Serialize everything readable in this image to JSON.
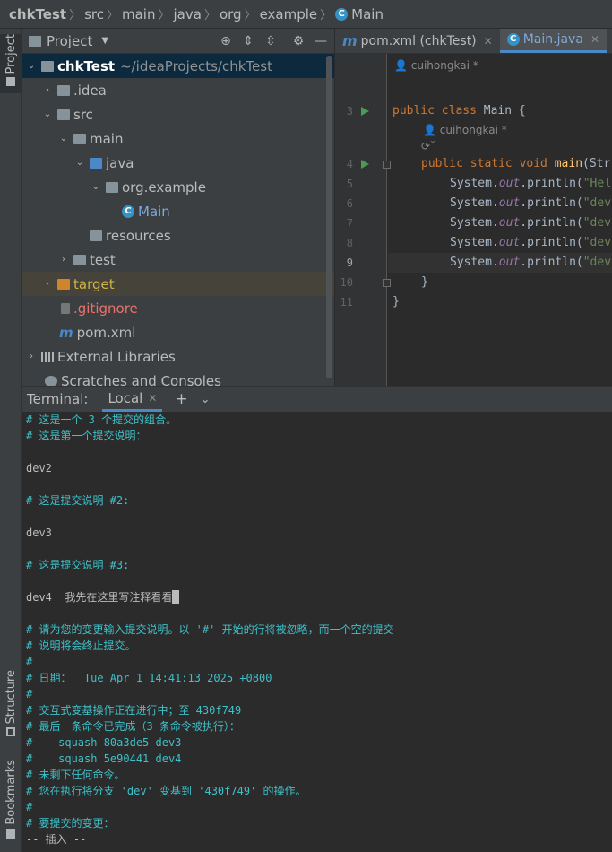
{
  "breadcrumb": [
    "chkTest",
    "src",
    "main",
    "java",
    "org",
    "example",
    "Main"
  ],
  "sidebar_left": {
    "project_tab": "Project",
    "structure_tab": "Structure",
    "bookmarks_tab": "Bookmarks"
  },
  "project_panel": {
    "title": "Project",
    "tree": [
      {
        "label": "chkTest",
        "path": "~/ideaProjects/chkTest"
      },
      {
        "label": ".idea"
      },
      {
        "label": "src"
      },
      {
        "label": "main"
      },
      {
        "label": "java"
      },
      {
        "label": "org.example"
      },
      {
        "label": "Main"
      },
      {
        "label": "resources"
      },
      {
        "label": "test"
      },
      {
        "label": "target"
      },
      {
        "label": ".gitignore"
      },
      {
        "label": "pom.xml"
      },
      {
        "label": "External Libraries"
      },
      {
        "label": "Scratches and Consoles"
      }
    ]
  },
  "editor": {
    "tabs": [
      {
        "label": "pom.xml (chkTest)"
      },
      {
        "label": "Main.java"
      }
    ],
    "author_hint_1": "cuihongkai *",
    "author_hint_2": "cuihongkai *",
    "line_numbers": [
      "3",
      "4",
      "5",
      "6",
      "7",
      "8",
      "9",
      "10",
      "11"
    ],
    "code": {
      "l3_kw": "public class ",
      "l3_rest": "Main {",
      "l4_kw": "public static void ",
      "l4_fn": "main",
      "l4_rest": "(Str",
      "l5_a": "System.",
      "l5_b": "out",
      "l5_c": ".println(",
      "l5_s": "\"Hel",
      "l6_s": "\"dev",
      "l7_s": "\"dev",
      "l8_s": "\"dev",
      "l9_s": "\"dev",
      "l10": "}",
      "l11": "}"
    }
  },
  "terminal": {
    "title": "Terminal:",
    "tab": "Local",
    "lines": [
      "# 这是一个 3 个提交的组合。",
      "# 这是第一个提交说明：",
      "",
      "dev2",
      "",
      "# 这是提交说明 #2:",
      "",
      "dev3",
      "",
      "# 这是提交说明 #3:",
      "",
      "dev4  我先在这里写注释看看",
      "",
      "# 请为您的变更输入提交说明。以 '#' 开始的行将被忽略，而一个空的提交",
      "# 说明将会终止提交。",
      "#",
      "# 日期：  Tue Apr 1 14:41:13 2025 +0800",
      "#",
      "# 交互式变基操作正在进行中；至 430f749",
      "# 最后一条命令已完成（3 条命令被执行）：",
      "#    squash 80a3de5 dev3",
      "#    squash 5e90441 dev4",
      "# 未剩下任何命令。",
      "# 您在执行将分支 'dev' 变基到 '430f749' 的操作。",
      "#",
      "# 要提交的变更：",
      "-- 插入 --"
    ]
  }
}
